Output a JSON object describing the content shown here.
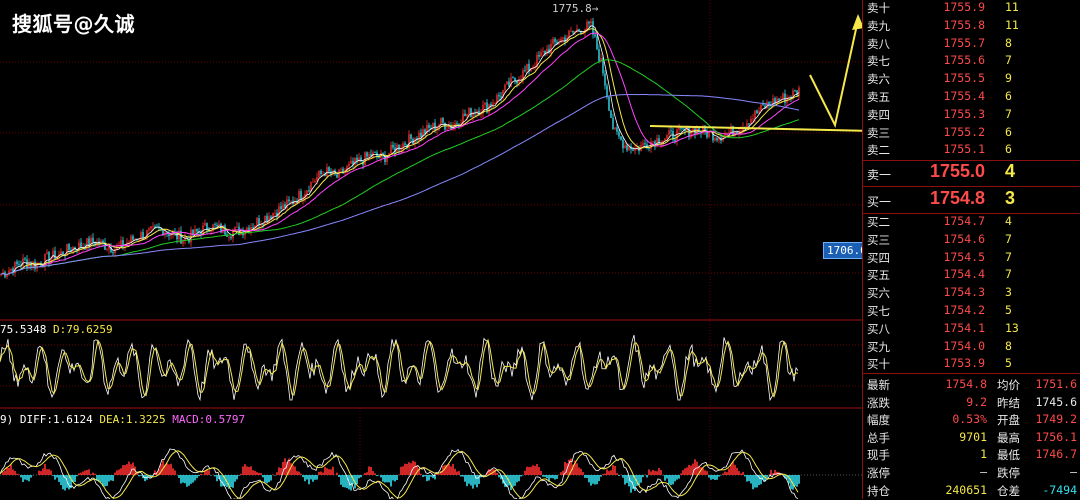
{
  "watermark": "搜狐号@久诚",
  "chart": {
    "peak_label": "1775.8→",
    "price_tag": "1706.0",
    "kdj_label_prefix": "75.5348",
    "kdj_label_d": "D:79.6259",
    "macd_label_prefix": "9)",
    "macd_label_diff": "DIFF:1.6124",
    "macd_label_dea": "DEA:1.3225",
    "macd_label_macd": "MACD:0.5797",
    "colors": {
      "up": "#ff3030",
      "down": "#33e0f0",
      "ma_white": "#ffffff",
      "ma_yellow": "#f5e84a",
      "ma_magenta": "#ff44ff",
      "ma_green": "#22cc22",
      "ma_blue": "#8888ff",
      "grid": "#6b0000",
      "annotation": "#f5e84a"
    }
  },
  "chart_data": {
    "type": "candlestick",
    "price_range": [
      1690,
      1780
    ],
    "peak": 1775.8,
    "reference_price": 1706.0,
    "close_path": [
      1698,
      1700,
      1702,
      1701,
      1703,
      1704,
      1706,
      1707,
      1708,
      1707,
      1706,
      1708,
      1710,
      1711,
      1712,
      1710,
      1709,
      1711,
      1713,
      1712,
      1711,
      1712,
      1714,
      1716,
      1718,
      1720,
      1723,
      1727,
      1730,
      1728,
      1731,
      1733,
      1735,
      1734,
      1737,
      1739,
      1741,
      1743,
      1745,
      1744,
      1747,
      1749,
      1750,
      1753,
      1757,
      1760,
      1763,
      1767,
      1770,
      1772,
      1774,
      1775,
      1762,
      1742,
      1738,
      1737,
      1739,
      1740,
      1741,
      1742,
      1743,
      1742,
      1741,
      1742,
      1744,
      1747,
      1750,
      1752,
      1753,
      1755
    ]
  },
  "book": {
    "asks": [
      {
        "label": "卖十",
        "price": "1755.9",
        "volume": "11"
      },
      {
        "label": "卖九",
        "price": "1755.8",
        "volume": "11"
      },
      {
        "label": "卖八",
        "price": "1755.7",
        "volume": "8"
      },
      {
        "label": "卖七",
        "price": "1755.6",
        "volume": "7"
      },
      {
        "label": "卖六",
        "price": "1755.5",
        "volume": "9"
      },
      {
        "label": "卖五",
        "price": "1755.4",
        "volume": "6"
      },
      {
        "label": "卖四",
        "price": "1755.3",
        "volume": "7"
      },
      {
        "label": "卖三",
        "price": "1755.2",
        "volume": "6"
      },
      {
        "label": "卖二",
        "price": "1755.1",
        "volume": "6"
      }
    ],
    "best_ask": {
      "label": "卖一",
      "price": "1755.0",
      "volume": "4"
    },
    "best_bid": {
      "label": "买一",
      "price": "1754.8",
      "volume": "3"
    },
    "bids": [
      {
        "label": "买二",
        "price": "1754.7",
        "volume": "4"
      },
      {
        "label": "买三",
        "price": "1754.6",
        "volume": "7"
      },
      {
        "label": "买四",
        "price": "1754.5",
        "volume": "7"
      },
      {
        "label": "买五",
        "price": "1754.4",
        "volume": "7"
      },
      {
        "label": "买六",
        "price": "1754.3",
        "volume": "3"
      },
      {
        "label": "买七",
        "price": "1754.2",
        "volume": "5"
      },
      {
        "label": "买八",
        "price": "1754.1",
        "volume": "13"
      },
      {
        "label": "买九",
        "price": "1754.0",
        "volume": "8"
      },
      {
        "label": "买十",
        "price": "1753.9",
        "volume": "5"
      }
    ],
    "stats": [
      {
        "k1": "最新",
        "v1": "1754.8",
        "c1": "#ff4a4a",
        "k2": "均价",
        "v2": "1751.6",
        "c2": "#ff4a4a"
      },
      {
        "k1": "涨跌",
        "v1": "9.2",
        "c1": "#ff4a4a",
        "k2": "昨结",
        "v2": "1745.6",
        "c2": "#e8e8e8"
      },
      {
        "k1": "幅度",
        "v1": "0.53%",
        "c1": "#ff4a4a",
        "k2": "开盘",
        "v2": "1749.2",
        "c2": "#ff4a4a"
      },
      {
        "k1": "总手",
        "v1": "9701",
        "c1": "#f5e84a",
        "k2": "最高",
        "v2": "1756.1",
        "c2": "#ff4a4a"
      },
      {
        "k1": "现手",
        "v1": "1",
        "c1": "#f5e84a",
        "k2": "最低",
        "v2": "1746.7",
        "c2": "#ff4a4a"
      },
      {
        "k1": "涨停",
        "v1": "—",
        "c1": "#e8e8e8",
        "k2": "跌停",
        "v2": "—",
        "c2": "#e8e8e8"
      },
      {
        "k1": "持仓",
        "v1": "240651",
        "c1": "#f5e84a",
        "k2": "仓差",
        "v2": "-7494",
        "c2": "#33e0f0"
      }
    ]
  }
}
